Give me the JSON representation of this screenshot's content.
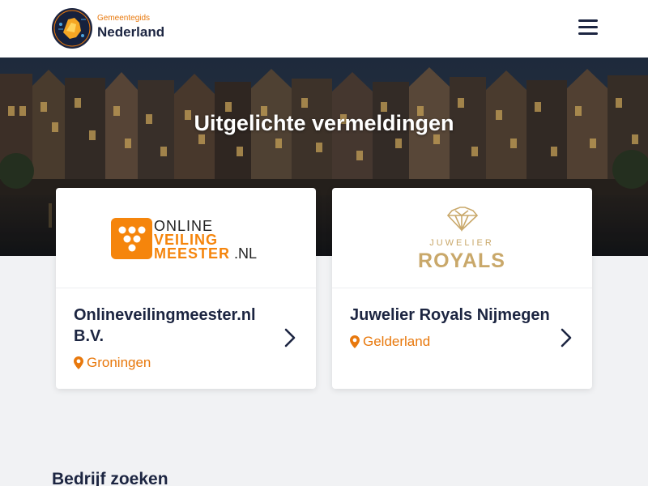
{
  "header": {
    "brand_sub": "Gemeentegids",
    "brand_main": "Nederland",
    "menu_icon": "hamburger-icon"
  },
  "hero": {
    "title": "Uitgelichte vermeldingen"
  },
  "listings": [
    {
      "logo_lines": [
        "ONLINE",
        "VEILING",
        "MEESTER",
        ".NL"
      ],
      "name": "Onlineveilingmeester.nl B.V.",
      "location": "Groningen"
    },
    {
      "logo_lines": [
        "JUWELIER",
        "ROYALS"
      ],
      "name": "Juwelier Royals Nijmegen",
      "location": "Gelderland"
    }
  ],
  "search_section": {
    "title": "Bedrijf zoeken"
  },
  "colors": {
    "accent": "#e8780c",
    "navy": "#1c2541",
    "gold": "#c9a86a"
  }
}
